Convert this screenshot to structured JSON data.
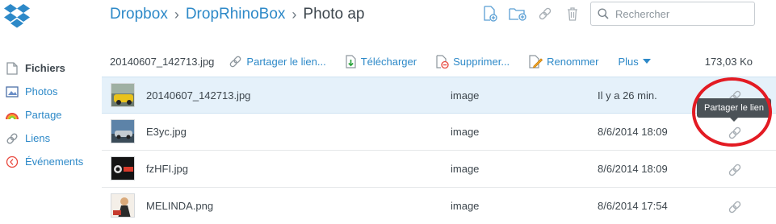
{
  "app": {
    "brand_color": "#2d89c8"
  },
  "sidebar": {
    "items": [
      {
        "label": "Fichiers",
        "icon": "files-icon"
      },
      {
        "label": "Photos",
        "icon": "photos-icon"
      },
      {
        "label": "Partage",
        "icon": "sharing-icon"
      },
      {
        "label": "Liens",
        "icon": "links-icon"
      },
      {
        "label": "Événements",
        "icon": "events-icon"
      }
    ]
  },
  "breadcrumb": {
    "root": "Dropbox",
    "folder": "DropRhinoBox",
    "current": "Photo ap"
  },
  "search": {
    "placeholder": "Rechercher"
  },
  "toolbar": {
    "selected_name": "20140607_142713.jpg",
    "share_link": "Partager le lien...",
    "download": "Télécharger",
    "delete": "Supprimer...",
    "rename": "Renommer",
    "more": "Plus",
    "selected_size": "173,03 Ko"
  },
  "files": [
    {
      "name": "20140607_142713.jpg",
      "type": "image",
      "modified": "Il y a 26 min."
    },
    {
      "name": "E3yc.jpg",
      "type": "image",
      "modified": "8/6/2014 18:09"
    },
    {
      "name": "fzHFI.jpg",
      "type": "image",
      "modified": "8/6/2014 18:09"
    },
    {
      "name": "MELINDA.png",
      "type": "image",
      "modified": "8/6/2014 17:54"
    }
  ],
  "tooltip": {
    "text": "Partager le lien"
  },
  "colors": {
    "accent": "#2d89c8",
    "selected_row": "#e5f1fa",
    "annotation": "#e31b23",
    "tooltip_bg": "#4b5257"
  }
}
